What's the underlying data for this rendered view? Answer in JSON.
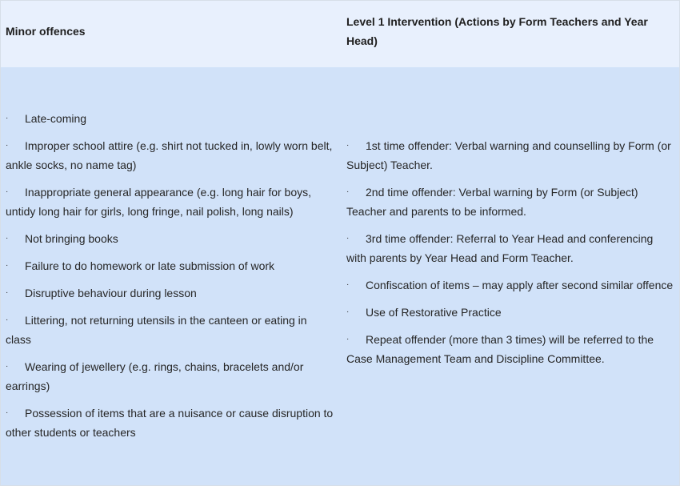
{
  "header": {
    "left": "Minor offences",
    "right": "Level 1 Intervention (Actions by Form Teachers and Year Head)"
  },
  "bullet": "·",
  "offences": [
    "Late-coming",
    "Improper school attire (e.g. shirt not tucked in, lowly worn belt, ankle socks, no name tag)",
    "Inappropriate general appearance (e.g. long hair for boys, untidy long hair for girls, long fringe, nail polish, long nails)",
    "Not bringing books",
    "Failure to do homework or late submission of work",
    "Disruptive behaviour during lesson",
    "Littering, not returning utensils in the canteen or eating in class",
    "Wearing of jewellery (e.g. rings, chains, bracelets and/or earrings)",
    "Possession of items that are a nuisance or cause disruption to other students or teachers"
  ],
  "interventions": [
    "1st time offender: Verbal warning and counselling by Form (or Subject) Teacher.",
    "2nd time offender: Verbal warning by Form (or Subject) Teacher and parents to be informed.",
    "3rd time offender: Referral to Year Head and conferencing with parents by Year Head and Form Teacher.",
    "Confiscation of items – may apply after second similar offence",
    "Use of Restorative Practice",
    "Repeat offender (more than 3 times) will be referred to the Case Management Team and Discipline Committee."
  ]
}
